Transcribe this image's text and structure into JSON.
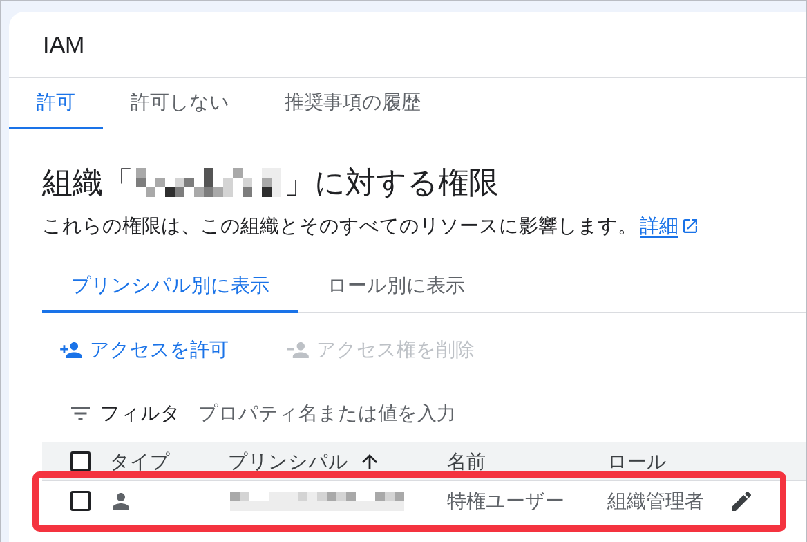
{
  "window": {
    "title": "IAM"
  },
  "tabs": [
    {
      "label": "許可",
      "selected": true
    },
    {
      "label": "許可しない",
      "selected": false
    },
    {
      "label": "推奨事項の履歴",
      "selected": false
    }
  ],
  "heading": {
    "prefix": "組織「",
    "suffix": "」に対する権限"
  },
  "description": {
    "text": "これらの権限は、この組織とそのすべてのリソースに影響します。",
    "link": "詳細"
  },
  "view_tabs": [
    {
      "label": "プリンシパル別に表示",
      "selected": true
    },
    {
      "label": "ロール別に表示",
      "selected": false
    }
  ],
  "actions": [
    {
      "kind": "add",
      "label": "アクセスを許可",
      "disabled": false
    },
    {
      "kind": "remove",
      "label": "アクセス権を削除",
      "disabled": true
    }
  ],
  "filter": {
    "label": "フィルタ",
    "placeholder": "プロパティ名または値を入力"
  },
  "table": {
    "select_all": {
      "checked": false
    },
    "columns": [
      {
        "label": "タイプ",
        "sorted": false
      },
      {
        "label": "プリンシパル",
        "sorted": true
      },
      {
        "label": "名前",
        "sorted": false
      },
      {
        "label": "ロール",
        "sorted": false
      }
    ],
    "rows": [
      {
        "checked": false,
        "highlighted": true,
        "name": "特権ユーザー",
        "role": "組織管理者"
      }
    ]
  }
}
